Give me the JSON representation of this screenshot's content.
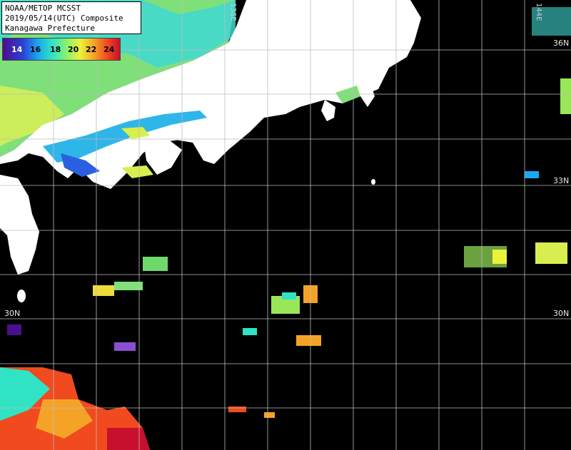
{
  "header": {
    "line1": "NOAA/METOP MCSST",
    "line2": "2019/05/14(UTC) Composite",
    "line3": "Kanagawa Prefecture"
  },
  "legend": {
    "ticks": [
      "14",
      "16",
      "18",
      "20",
      "22",
      "24"
    ],
    "colors": [
      "#4b0f8f",
      "#1aa8f0",
      "#2fe3c4",
      "#ecf23a",
      "#f5a327",
      "#f04a1e",
      "#c8102e"
    ]
  },
  "grid": {
    "lon_labels": [
      "136E",
      "144E"
    ],
    "lat_labels": {
      "n36": "36N",
      "n33": "33N",
      "n30_left": "30N",
      "n30_right": "30N"
    }
  },
  "colors": {
    "land": "#ffffff",
    "ocean": "#000000",
    "grid": "#bdbdbd"
  }
}
